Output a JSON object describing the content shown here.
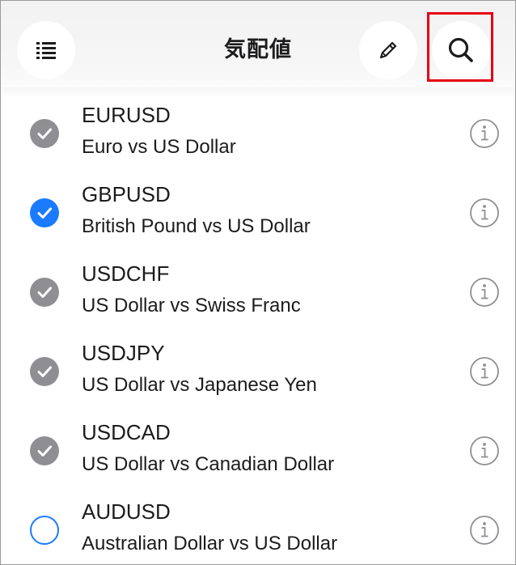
{
  "header": {
    "title": "気配値",
    "menu_icon": "list-icon",
    "edit_icon": "pencil-icon",
    "search_icon": "search-icon"
  },
  "colors": {
    "highlight": "#e60012",
    "selected": "#1a7bff",
    "disabled": "#8e8e93"
  },
  "symbols": [
    {
      "symbol": "EURUSD",
      "description": "Euro vs US Dollar",
      "state": "gray-checked"
    },
    {
      "symbol": "GBPUSD",
      "description": "British Pound vs US Dollar",
      "state": "blue-checked"
    },
    {
      "symbol": "USDCHF",
      "description": "US Dollar vs Swiss Franc",
      "state": "gray-checked"
    },
    {
      "symbol": "USDJPY",
      "description": "US Dollar vs Japanese Yen",
      "state": "gray-checked"
    },
    {
      "symbol": "USDCAD",
      "description": "US Dollar vs Canadian Dollar",
      "state": "gray-checked"
    },
    {
      "symbol": "AUDUSD",
      "description": "Australian Dollar vs US Dollar",
      "state": "unchecked"
    }
  ]
}
